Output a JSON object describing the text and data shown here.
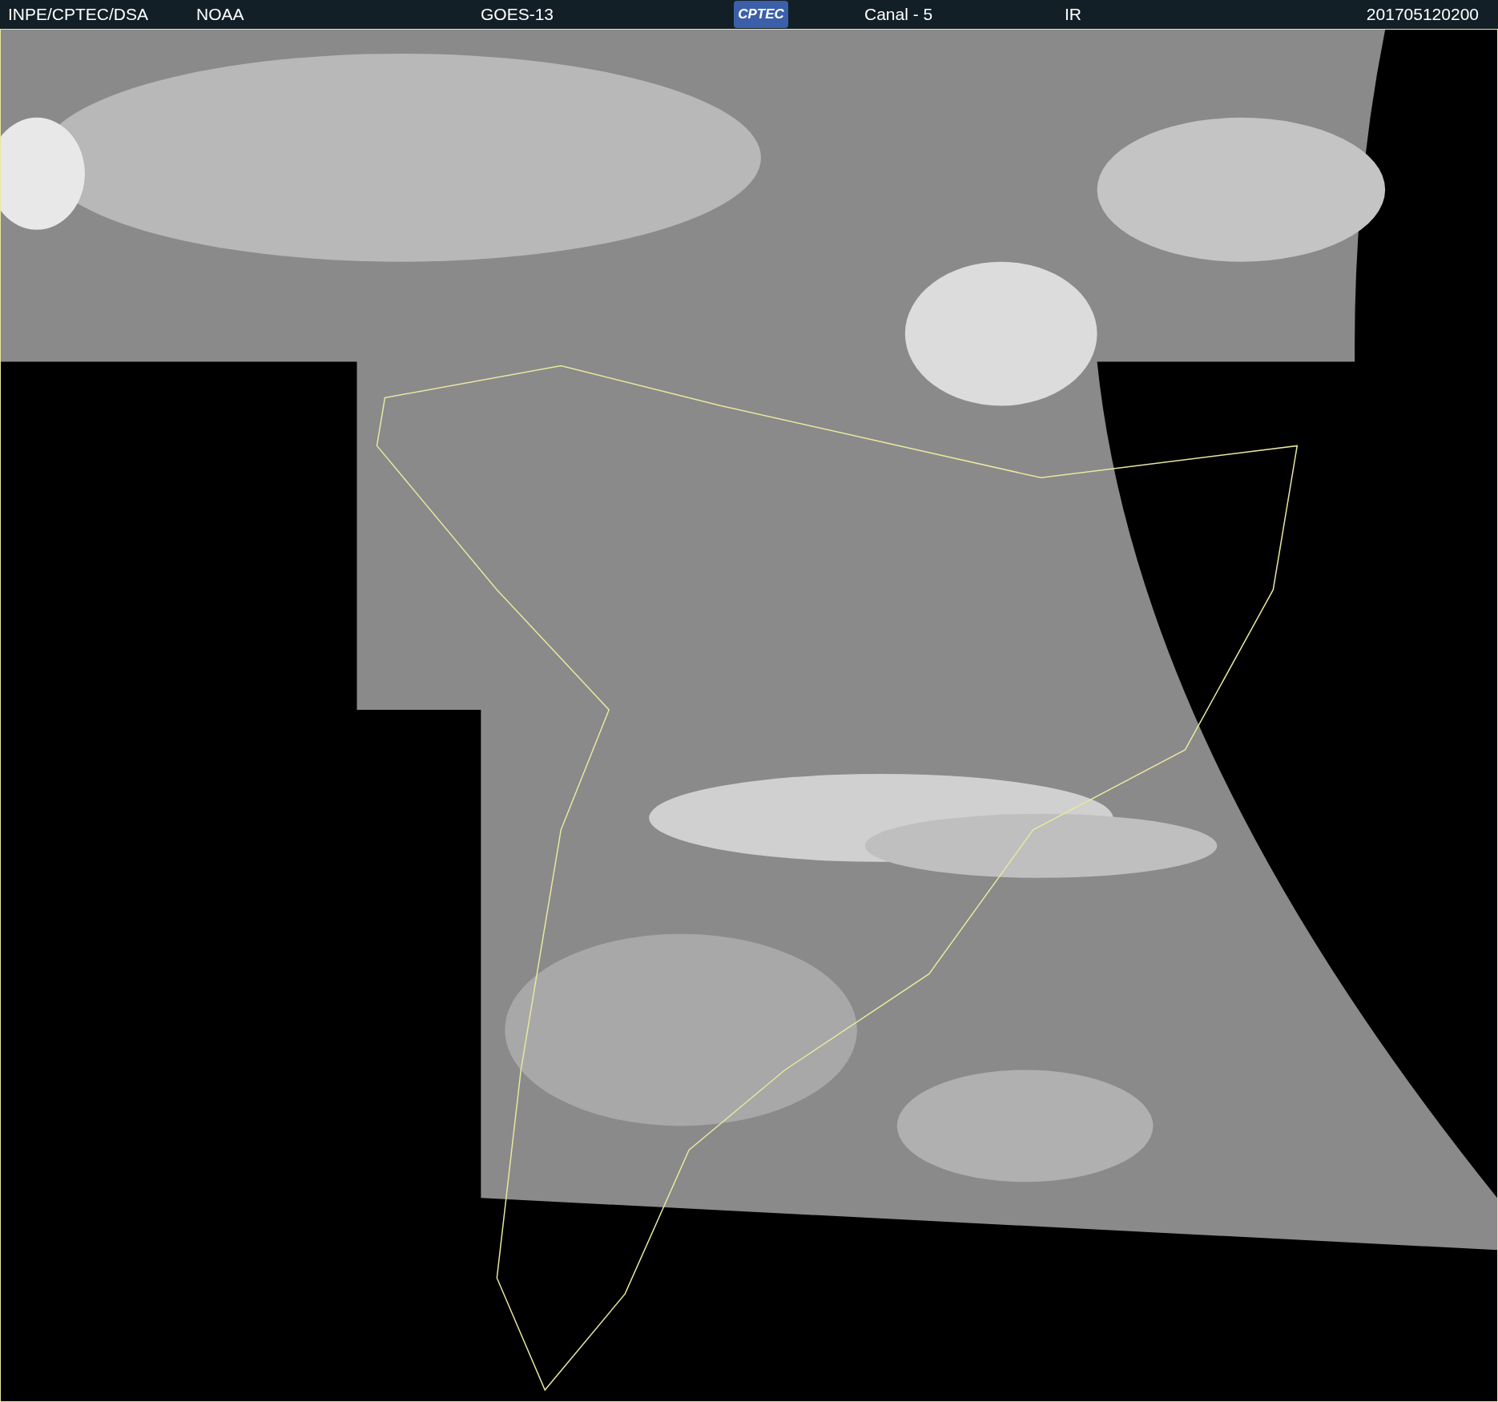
{
  "header": {
    "agency": "INPE/CPTEC/DSA",
    "source": "NOAA",
    "satellite": "GOES-13",
    "logo_text": "CPTEC",
    "channel": "Canal - 5",
    "band": "IR",
    "timestamp": "201705120200"
  }
}
